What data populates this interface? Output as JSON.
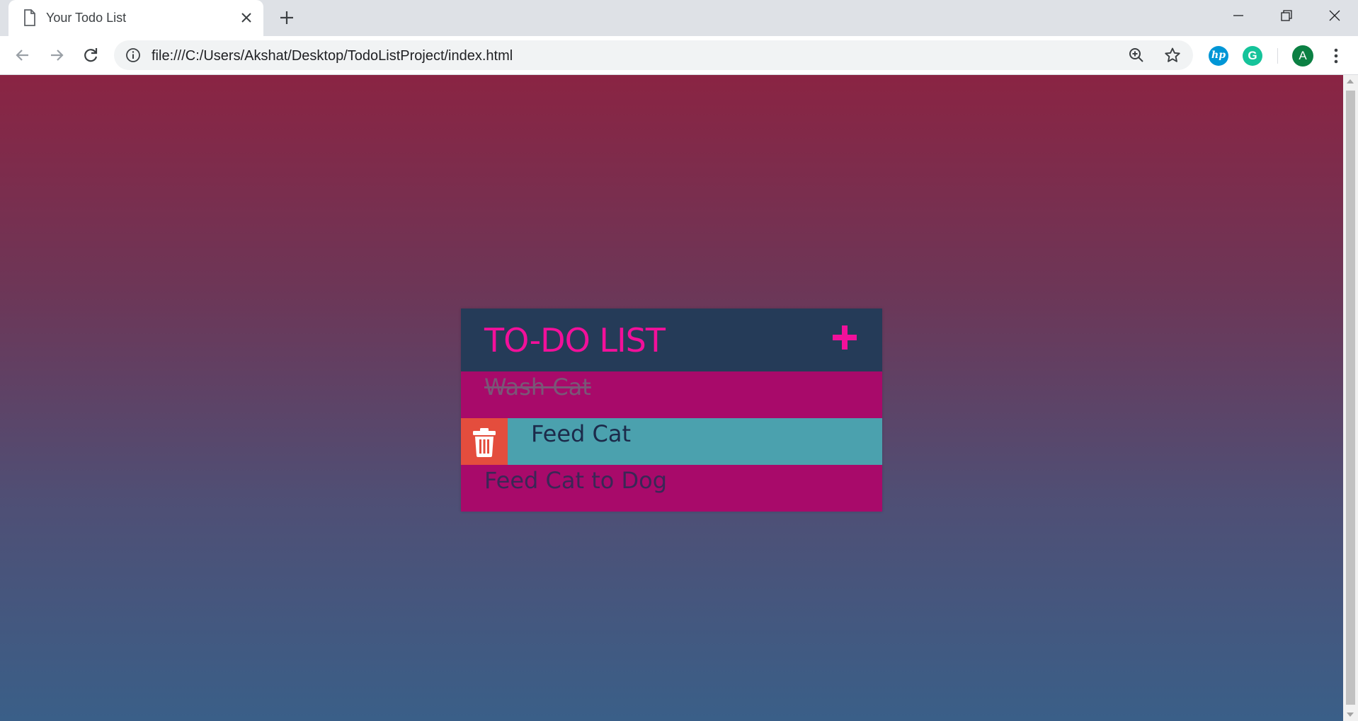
{
  "browser": {
    "tab_title": "Your Todo List",
    "url": "file:///C:/Users/Akshat/Desktop/TodoListProject/index.html",
    "profile_initial": "A",
    "extension_hp_label": "hp",
    "extension_grammarly_label": "G"
  },
  "todo": {
    "title": "TO-DO LIST",
    "add_icon": "plus-icon",
    "items": [
      {
        "label": "Wash Cat",
        "completed": true
      },
      {
        "label": "Feed Cat",
        "completed": false,
        "hovered": true
      },
      {
        "label": "Feed Cat to Dog",
        "completed": false
      }
    ],
    "delete_icon": "trash-icon"
  },
  "colors": {
    "header_bg": "#253b58",
    "title": "#f2109a",
    "item_bg": "#a80a6a",
    "hover_bg": "#4ba1ae",
    "delete_bg": "#e44d3d",
    "gradient_top": "#8a2443",
    "gradient_bottom": "#3a5f88"
  }
}
